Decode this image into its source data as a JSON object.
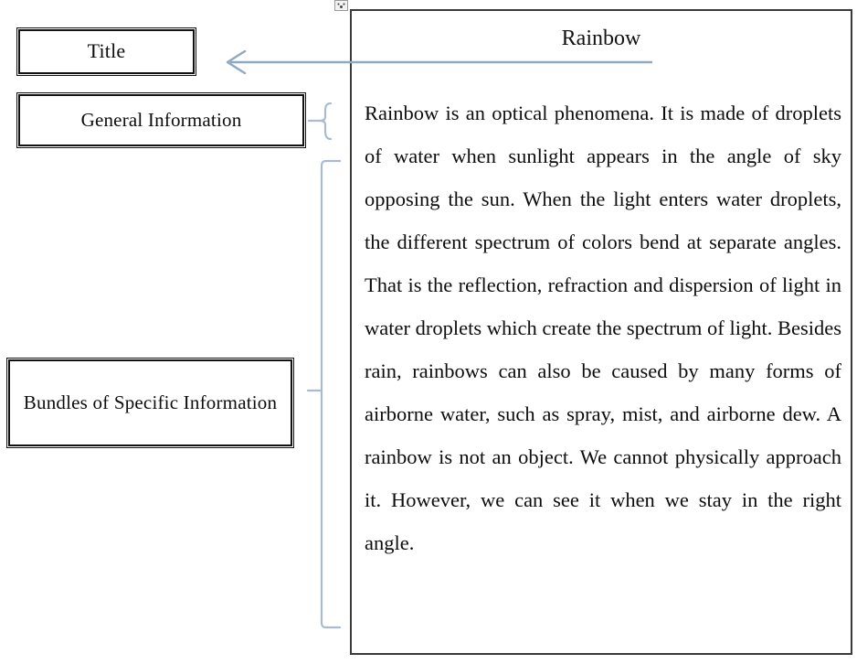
{
  "diagram": {
    "labels": [
      {
        "id": "title",
        "text": "Title"
      },
      {
        "id": "general",
        "text": "General Information"
      },
      {
        "id": "bundles",
        "text": "Bundles of Specific Information"
      }
    ],
    "connectors": [
      {
        "id": "title-arrow",
        "kind": "arrow-left",
        "color": "#8ea9c1"
      },
      {
        "id": "general-brace",
        "kind": "curly-brace",
        "color": "#a9bccf"
      },
      {
        "id": "bundles-bracket",
        "kind": "square-bracket",
        "color": "#a9bccf"
      }
    ],
    "anchor_marker_icon": "anchor-marker-icon"
  },
  "document": {
    "title": "Rainbow",
    "body": "Rainbow is an optical phenomena. It is made of droplets of water when sunlight appears in the angle of sky opposing the sun. When the light enters water droplets, the different spectrum of colors bend at separate angles. That is the reflection, refraction and dispersion of light in water droplets which create the spectrum of light. Besides rain, rainbows can also be caused by many forms of airborne water, such as spray, mist, and airborne dew. A rainbow is not an object. We cannot physically approach it. However, we can see it when we stay in the right angle.",
    "border_color": "#3a3a3a"
  },
  "colors": {
    "box_border": "#121212",
    "connector_blue": "#a9bccf",
    "arrow_blue": "#8ea9c1",
    "text": "#0d0d0d",
    "background": "#ffffff"
  }
}
